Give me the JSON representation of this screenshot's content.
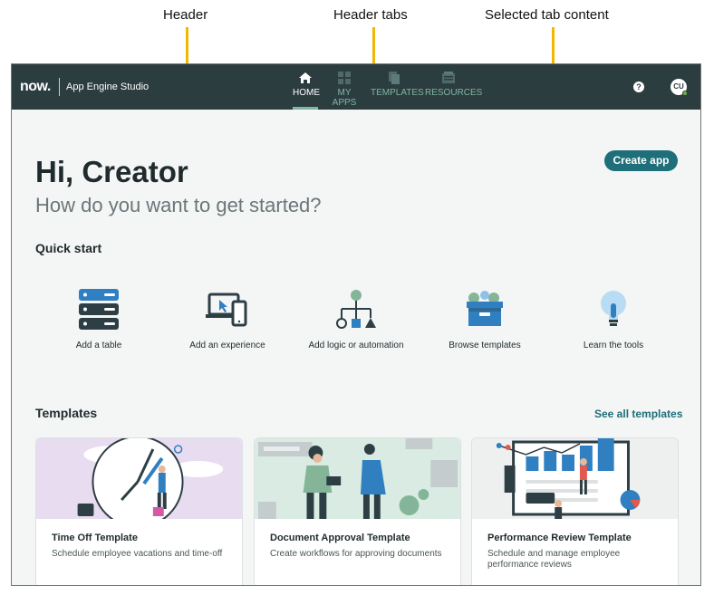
{
  "annotations": {
    "header": "Header",
    "header_tabs": "Header tabs",
    "selected_tab_content": "Selected tab content"
  },
  "topbar": {
    "logo": "now.",
    "app_name": "App Engine Studio",
    "tabs": [
      {
        "label": "HOME",
        "icon": "home-icon",
        "active": true
      },
      {
        "label": "MY APPS",
        "icon": "grid-icon",
        "active": false
      },
      {
        "label": "TEMPLATES",
        "icon": "templates-icon",
        "active": false
      },
      {
        "label": "RESOURCES",
        "icon": "resources-icon",
        "active": false
      }
    ],
    "help": "?",
    "avatar": "CU"
  },
  "hero": {
    "title": "Hi, Creator",
    "subtitle": "How do you want to get started?",
    "create_button": "Create app"
  },
  "quick_start": {
    "title": "Quick start",
    "items": [
      {
        "label": "Add a table",
        "icon": "table-icon"
      },
      {
        "label": "Add an experience",
        "icon": "devices-icon"
      },
      {
        "label": "Add logic or automation",
        "icon": "flow-icon"
      },
      {
        "label": "Browse templates",
        "icon": "box-icon"
      },
      {
        "label": "Learn the tools",
        "icon": "lightbulb-icon"
      }
    ]
  },
  "templates": {
    "title": "Templates",
    "see_all": "See all templates",
    "cards": [
      {
        "title": "Time Off Template",
        "description": "Schedule employee vacations and time-off"
      },
      {
        "title": "Document Approval Template",
        "description": "Create workflows for approving documents"
      },
      {
        "title": "Performance Review Template",
        "description": "Schedule and manage employee performance reviews"
      }
    ]
  },
  "colors": {
    "header_bg": "#2c3d40",
    "accent": "#1e6f7a",
    "tab_inactive": "#81b5a1",
    "annotation_arrow": "#f2b705"
  }
}
